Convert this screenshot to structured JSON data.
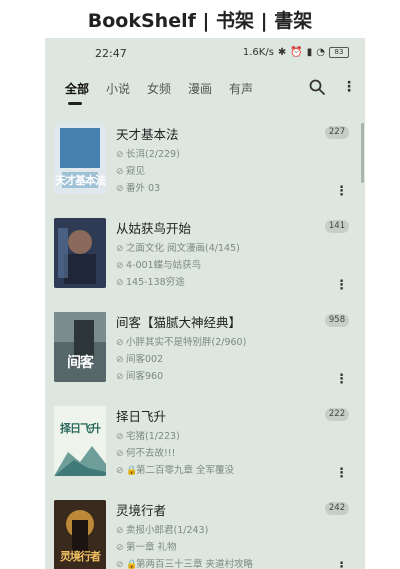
{
  "banner": {
    "title": "BookShelf | 书架 | 書架"
  },
  "status": {
    "time": "22:47",
    "speed": "1.6K/s",
    "battery": "83"
  },
  "tabs": [
    {
      "label": "全部",
      "active": true
    },
    {
      "label": "小说"
    },
    {
      "label": "女频"
    },
    {
      "label": "漫画"
    },
    {
      "label": "有声"
    }
  ],
  "icons": {
    "search": "search-icon",
    "more": "more-vertical-icon"
  },
  "books": [
    {
      "title": "天才基本法",
      "count": "227",
      "line1": "长洱(2/229)",
      "line2": "窥见",
      "line3": "番外 03",
      "cover_text": "天才基本法",
      "cover_color": "#d8e4ea",
      "lock": false
    },
    {
      "title": "从姑获鸟开始",
      "count": "141",
      "line1": "之面文化 阅文漫画(4/145)",
      "line2": "4-001蝶与姑获鸟",
      "line3": "145-138穷途",
      "cover_text": "",
      "cover_color": "#3c4a66",
      "lock": false
    },
    {
      "title": "间客【猫腻大神经典】",
      "count": "958",
      "line1": "小胖其实不是特别胖(2/960)",
      "line2": "间客002",
      "line3": "间客960",
      "cover_text": "间客",
      "cover_color": "#4a5a5e",
      "lock": false
    },
    {
      "title": "择日飞升",
      "count": "222",
      "line1": "宅猪(1/223)",
      "line2": "何不去故!!!",
      "line3": "第二百零九章 全军覆没",
      "cover_text": "择日飞升",
      "cover_color": "#e8efe6",
      "lock": true
    },
    {
      "title": "灵境行者",
      "count": "242",
      "line1": "卖报小郎君(1/243)",
      "line2": "第一章 礼物",
      "line3": "第两百三十三章 夹道村攻略",
      "cover_text": "灵境行者",
      "cover_color": "#3a2a1e",
      "lock": true
    }
  ]
}
